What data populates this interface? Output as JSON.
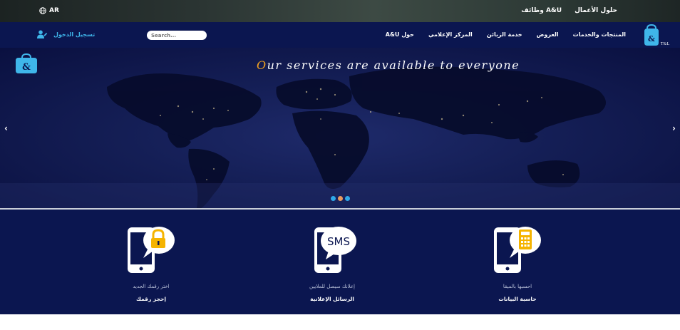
{
  "topbar": {
    "lang_label": "AR",
    "links": [
      "حلول الأعمال",
      "وظائف A&U"
    ]
  },
  "navbar": {
    "logo_text": "T&L",
    "menu": [
      "المنتجات والخدمات",
      "العروض",
      "خدمة الزبائن",
      "المركز الإعلامي",
      "حول A&U"
    ],
    "search_placeholder": "Search...",
    "login_label": "تسجيل الدخول"
  },
  "hero": {
    "tagline_first": "O",
    "tagline_rest": "ur services are available to everyone",
    "prev_arrow": "‹",
    "next_arrow": "›",
    "slide_count": 3,
    "active_slide": 2
  },
  "services": [
    {
      "icon": "phone-sms-icon",
      "desc": "إعلانك سيصل للملايين",
      "title": "الرسائل الإعلانية"
    },
    {
      "icon": "phone-lock-icon",
      "desc": "اختر رقمك الجديد",
      "title": "إحجز رقمك"
    },
    {
      "icon": "phone-calculator-icon",
      "desc": "احسبها بالميقا",
      "title": "حاسبة البيانات"
    }
  ],
  "sms_bubble_text": "SMS",
  "colors": {
    "navy": "#0b1650",
    "accent_blue": "#3fb6ea",
    "accent_orange": "#f0a020"
  }
}
